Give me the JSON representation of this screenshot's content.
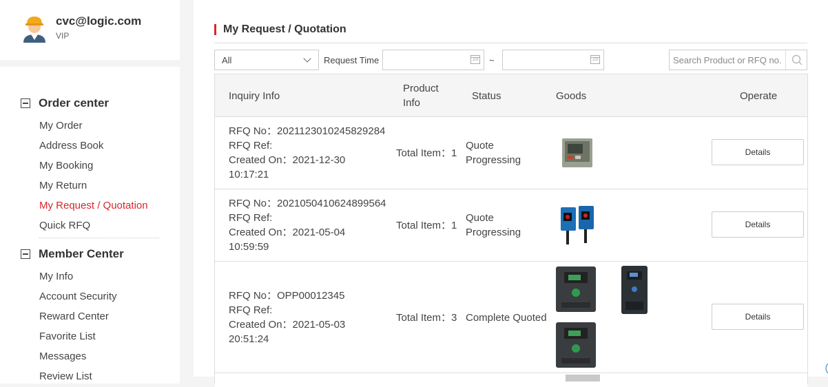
{
  "profile": {
    "email": "cvc@logic.com",
    "level": "VIP"
  },
  "sidebar": {
    "order_center": {
      "title": "Order center",
      "items": [
        "My Order",
        "Address Book",
        "My Booking",
        "My Return",
        "My Request / Quotation",
        "Quick RFQ"
      ]
    },
    "member_center": {
      "title": "Member Center",
      "items": [
        "My Info",
        "Account Security",
        "Reward Center",
        "Favorite List",
        "Messages",
        "Review List"
      ]
    },
    "active_item": "My Request / Quotation",
    "accent_color": "#d9252b"
  },
  "page": {
    "title": "My Request / Quotation"
  },
  "filters": {
    "status_selected": "All",
    "request_time_label": "Request Time",
    "date_separator": "~",
    "date_from": "",
    "date_to": "",
    "calendar_icon_text": "23",
    "search_placeholder": "Search Product or RFQ no."
  },
  "table": {
    "headers": {
      "inquiry_info": "Inquiry Info",
      "product_info_line1": "Product",
      "product_info_line2": "Info",
      "status": "Status",
      "goods": "Goods",
      "operate": "Operate"
    },
    "rows": [
      {
        "rfq_no": "RFQ No：2021123010245829284",
        "rfq_ref": "RFQ Ref:",
        "created_on": "Created On：2021-12-30",
        "created_time": "10:17:21",
        "total_item": "Total Item：1",
        "status_line1": "Quote",
        "status_line2": "Progressing",
        "goods_icons": [
          "display-module-image"
        ],
        "action": "Details"
      },
      {
        "rfq_no": "RFQ No：2021050410624899564",
        "rfq_ref": "RFQ Ref:",
        "created_on": "Created On：2021-05-04",
        "created_time": "10:59:59",
        "total_item": "Total Item：1",
        "status_line1": "Quote",
        "status_line2": "Progressing",
        "goods_icons": [
          "photoelectric-sensor-image"
        ],
        "action": "Details"
      },
      {
        "rfq_no": "RFQ No：OPP00012345",
        "rfq_ref": "RFQ Ref:",
        "created_on": "Created On：2021-05-03",
        "created_time": "20:51:24",
        "total_item": "Total Item：3",
        "status_line1": "Complete Quoted",
        "status_line2": "",
        "goods_icons": [
          "variable-speed-drive-image",
          "variable-speed-drive-image",
          "variable-speed-drive-image"
        ],
        "action": "Details"
      }
    ]
  }
}
